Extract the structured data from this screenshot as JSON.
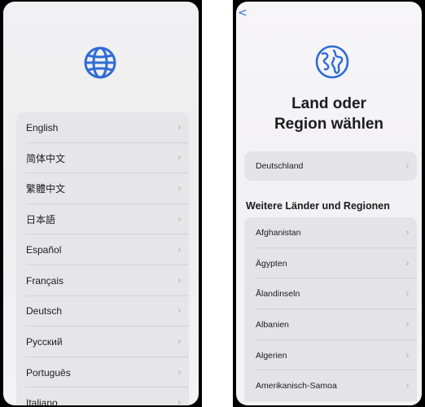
{
  "language_screen": {
    "globe_icon": "globe-icon",
    "languages": [
      "English",
      "简体中文",
      "繁體中文",
      "日本語",
      "Español",
      "Français",
      "Deutsch",
      "Русский",
      "Português",
      "Italiano"
    ],
    "chevron": "›"
  },
  "region_screen": {
    "back_chevron": "<",
    "earth_icon": "earth-globe-icon",
    "title_line1": "Land oder",
    "title_line2": "Region wählen",
    "current_region": "Deutschland",
    "section_header": "Weitere Länder und Regionen",
    "regions": [
      "Afghanistan",
      "Ägypten",
      "Ålandinseln",
      "Albanien",
      "Algerien",
      "Amerikanisch-Samoa"
    ],
    "chevron": "›"
  },
  "colors": {
    "accent": "#2f6bd6",
    "row_background": "#e6e6e9"
  }
}
